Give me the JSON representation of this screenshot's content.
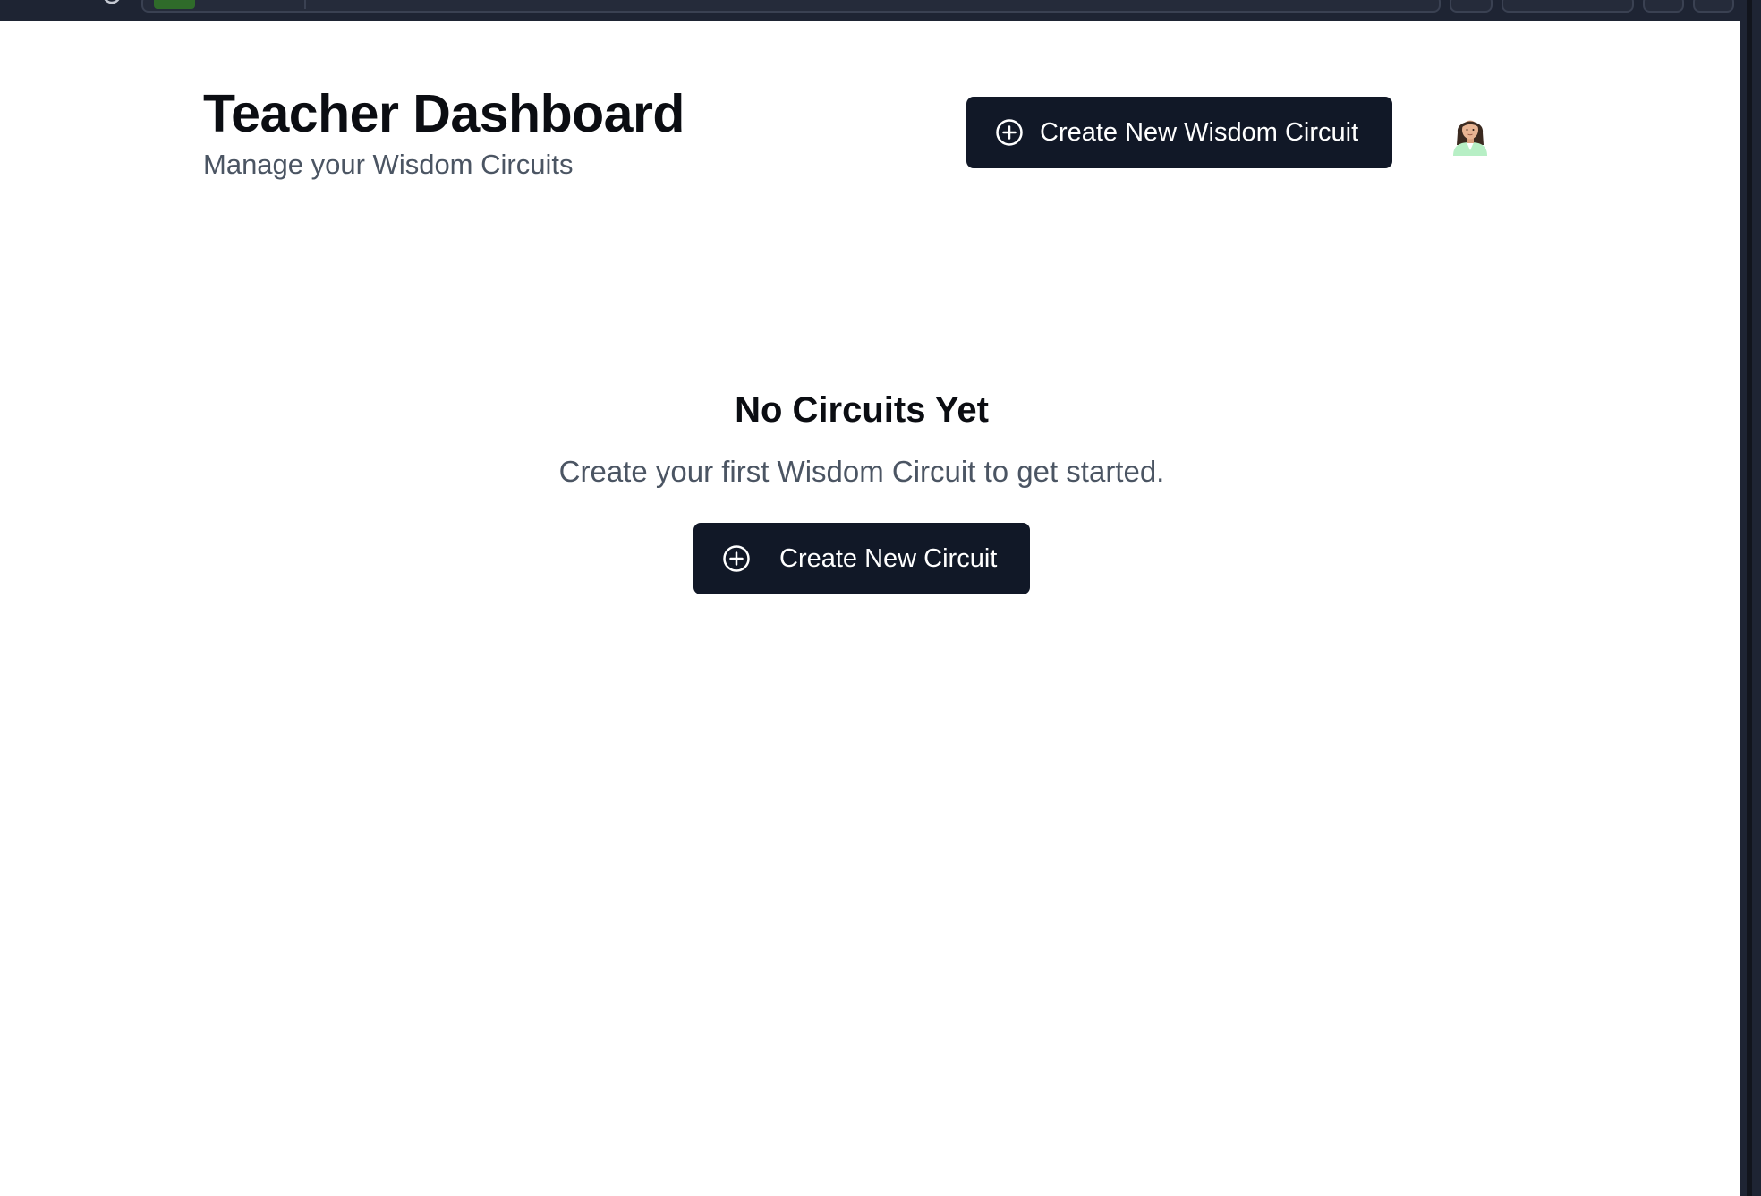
{
  "header": {
    "title": "Teacher Dashboard",
    "subtitle": "Manage your Wisdom Circuits",
    "create_button_label": "Create New Wisdom Circuit"
  },
  "empty_state": {
    "title": "No Circuits Yet",
    "description": "Create your first Wisdom Circuit to get started.",
    "button_label": "Create New Circuit"
  },
  "icons": {
    "create_icon": "plus-circle-icon",
    "avatar": "teacher-avatar"
  },
  "colors": {
    "button_bg": "#111827",
    "title_text": "#0b0d12",
    "muted_text": "#4b5563",
    "browser_chrome": "#1e2433"
  }
}
